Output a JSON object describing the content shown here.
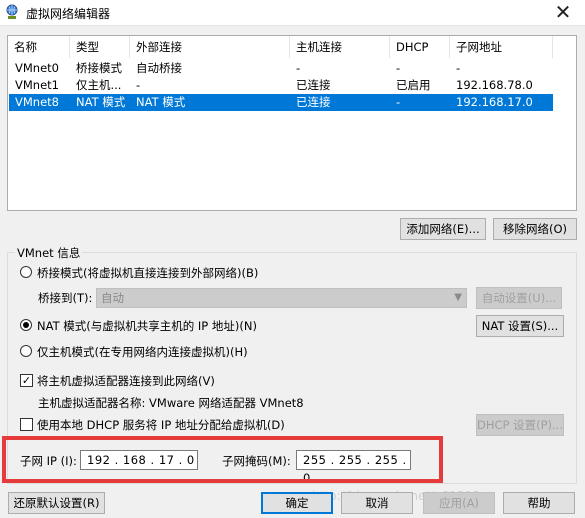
{
  "window": {
    "title": "虚拟网络编辑器",
    "icon": "network-globe-icon",
    "close_glyph": "✕"
  },
  "network_table": {
    "headers": [
      "名称",
      "类型",
      "外部连接",
      "主机连接",
      "DHCP",
      "子网地址"
    ],
    "rows": [
      {
        "name": "VMnet0",
        "type": "桥接模式",
        "external": "自动桥接",
        "host": "-",
        "dhcp": "-",
        "subnet": "-"
      },
      {
        "name": "VMnet1",
        "type": "仅主机...",
        "external": "-",
        "host": "已连接",
        "dhcp": "已启用",
        "subnet": "192.168.78.0"
      },
      {
        "name": "VMnet8",
        "type": "NAT 模式",
        "external": "NAT 模式",
        "host": "已连接",
        "dhcp": "-",
        "subnet": "192.168.17.0",
        "selected": true
      }
    ]
  },
  "buttons": {
    "add_network": "添加网络(E)...",
    "remove_network": "移除网络(O)",
    "auto_settings": "自动设置(U)...",
    "nat_settings": "NAT 设置(S)...",
    "dhcp_settings": "DHCP 设置(P)...",
    "restore_defaults": "还原默认设置(R)",
    "ok": "确定",
    "cancel": "取消",
    "apply": "应用(A)",
    "help": "帮助"
  },
  "vmnet_info": {
    "group_title": "VMnet 信息",
    "bridged_mode": "桥接模式(将虚拟机直接连接到外部网络)(B)",
    "bridged_to_label": "桥接到(T):",
    "bridged_to_value": "自动",
    "nat_mode": "NAT 模式(与虚拟机共享主机的 IP 地址)(N)",
    "host_only_mode": "仅主机模式(在专用网络内连接虚拟机)(H)",
    "selected_mode": "nat",
    "connect_adapter": "将主机虚拟适配器连接到此网络(V)",
    "connect_adapter_checked": true,
    "adapter_name": "主机虚拟适配器名称: VMware 网络适配器 VMnet8",
    "use_dhcp": "使用本地 DHCP 服务将 IP 地址分配给虚拟机(D)",
    "use_dhcp_checked": false
  },
  "subnet": {
    "ip_label": "子网 IP (I):",
    "ip_value": "192 . 168 . 17 . 0",
    "mask_label": "子网掩码(M):",
    "mask_value": "255 . 255 . 255 . 0"
  },
  "watermark": "http://blog.csdn.net/u01313",
  "colors": {
    "selection": "#0078d7",
    "highlight_box": "#e53b3b"
  }
}
